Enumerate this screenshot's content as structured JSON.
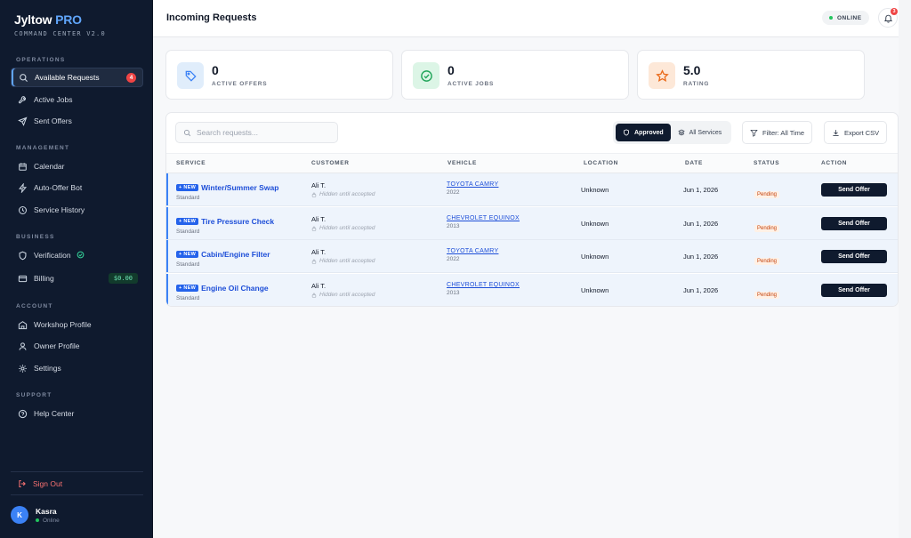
{
  "brand": {
    "name": "Jyltow",
    "pro": "PRO",
    "subtitle": "COMMAND CENTER V2.0"
  },
  "sidebar": {
    "sections": [
      {
        "label": "OPERATIONS",
        "items": [
          {
            "label": "Available Requests",
            "icon": "search-icon",
            "badge": "4",
            "active": true
          },
          {
            "label": "Active Jobs",
            "icon": "wrench-icon"
          },
          {
            "label": "Sent Offers",
            "icon": "send-icon"
          }
        ]
      },
      {
        "label": "MANAGEMENT",
        "items": [
          {
            "label": "Calendar",
            "icon": "calendar-icon"
          },
          {
            "label": "Auto-Offer Bot",
            "icon": "bolt-icon"
          },
          {
            "label": "Service History",
            "icon": "history-icon"
          }
        ]
      },
      {
        "label": "BUSINESS",
        "items": [
          {
            "label": "Verification",
            "icon": "shield-icon",
            "verified_icon": "check-circle-icon"
          },
          {
            "label": "Billing",
            "icon": "credit-card-icon",
            "balance": "$0.00"
          }
        ]
      },
      {
        "label": "ACCOUNT",
        "items": [
          {
            "label": "Workshop Profile",
            "icon": "building-icon"
          },
          {
            "label": "Owner Profile",
            "icon": "user-icon"
          },
          {
            "label": "Settings",
            "icon": "gear-icon"
          }
        ]
      },
      {
        "label": "SUPPORT",
        "items": [
          {
            "label": "Help Center",
            "icon": "help-circle-icon"
          }
        ]
      }
    ],
    "sign_out": "Sign Out",
    "user": {
      "initial": "K",
      "name": "Kasra",
      "status": "Online"
    }
  },
  "header": {
    "title": "Incoming Requests",
    "status": "ONLINE",
    "notification_count": "3"
  },
  "stats": [
    {
      "value": "0",
      "label": "ACTIVE OFFERS",
      "icon": "tag-icon"
    },
    {
      "value": "0",
      "label": "ACTIVE JOBS",
      "icon": "check-circle-icon"
    },
    {
      "value": "5.0",
      "label": "RATING",
      "icon": "star-icon"
    }
  ],
  "toolbar": {
    "search_placeholder": "Search requests...",
    "segments": [
      {
        "label": "Approved",
        "active": true
      },
      {
        "label": "All Services",
        "active": false
      }
    ],
    "filter_label": "Filter: All Time",
    "export_label": "Export CSV"
  },
  "table": {
    "columns": [
      "SERVICE",
      "CUSTOMER",
      "VEHICLE",
      "LOCATION",
      "DATE",
      "STATUS",
      "ACTION"
    ],
    "rows": [
      {
        "badge": "+ NEW",
        "service": "Winter/Summer Swap",
        "tier": "Standard",
        "customer": "Ali T.",
        "customer_note": "Hidden until accepted",
        "vehicle": "TOYOTA CAMRY",
        "year": "2022",
        "location": "Unknown",
        "date": "Jun 1, 2026",
        "status": "Pending",
        "action": "Send Offer"
      },
      {
        "badge": "+ NEW",
        "service": "Tire Pressure Check",
        "tier": "Standard",
        "customer": "Ali T.",
        "customer_note": "Hidden until accepted",
        "vehicle": "CHEVROLET EQUINOX",
        "year": "2013",
        "location": "Unknown",
        "date": "Jun 1, 2026",
        "status": "Pending",
        "action": "Send Offer"
      },
      {
        "badge": "+ NEW",
        "service": "Cabin/Engine Filter",
        "tier": "Standard",
        "customer": "Ali T.",
        "customer_note": "Hidden until accepted",
        "vehicle": "TOYOTA CAMRY",
        "year": "2022",
        "location": "Unknown",
        "date": "Jun 1, 2026",
        "status": "Pending",
        "action": "Send Offer"
      },
      {
        "badge": "+ NEW",
        "service": "Engine Oil Change",
        "tier": "Standard",
        "customer": "Ali T.",
        "customer_note": "Hidden until accepted",
        "vehicle": "CHEVROLET EQUINOX",
        "year": "2013",
        "location": "Unknown",
        "date": "Jun 1, 2026",
        "status": "Pending",
        "action": "Send Offer"
      }
    ]
  }
}
